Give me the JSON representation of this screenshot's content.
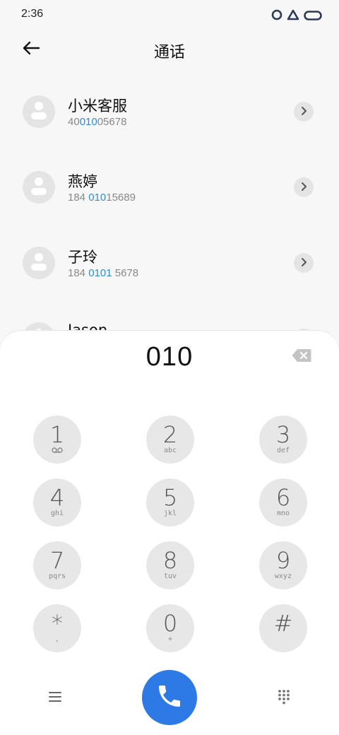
{
  "status_bar": {
    "time": "2:36",
    "icons": [
      "circle-app-icon",
      "triangle-app-icon",
      "pill-app-icon"
    ]
  },
  "header": {
    "title": "通话",
    "back_icon": "arrow-left-icon"
  },
  "contacts": [
    {
      "name": "小米客服",
      "number_prefix": "40",
      "number_match": "010",
      "number_suffix": "05678"
    },
    {
      "name": "燕婷",
      "number_prefix": "184 ",
      "number_match": "010",
      "number_suffix": "15689"
    },
    {
      "name": "子玲",
      "number_prefix": "184 ",
      "number_match": "0101",
      "number_suffix": " 5678"
    },
    {
      "name": "Jason",
      "number_prefix": "",
      "number_match": "",
      "number_suffix": ""
    }
  ],
  "dialer": {
    "display": "010",
    "keys": [
      {
        "digit": "1",
        "letters": ""
      },
      {
        "digit": "2",
        "letters": "abc"
      },
      {
        "digit": "3",
        "letters": "def"
      },
      {
        "digit": "4",
        "letters": "ghi"
      },
      {
        "digit": "5",
        "letters": "jkl"
      },
      {
        "digit": "6",
        "letters": "mno"
      },
      {
        "digit": "7",
        "letters": "pqrs"
      },
      {
        "digit": "8",
        "letters": "tuv"
      },
      {
        "digit": "9",
        "letters": "wxyz"
      },
      {
        "digit": "*",
        "letters": ","
      },
      {
        "digit": "0",
        "letters": "+"
      },
      {
        "digit": "#",
        "letters": ""
      }
    ]
  },
  "colors": {
    "accent_blue": "#2d7ae6",
    "match_blue": "#2b8fd6",
    "key_bg": "#e7e7e7"
  }
}
